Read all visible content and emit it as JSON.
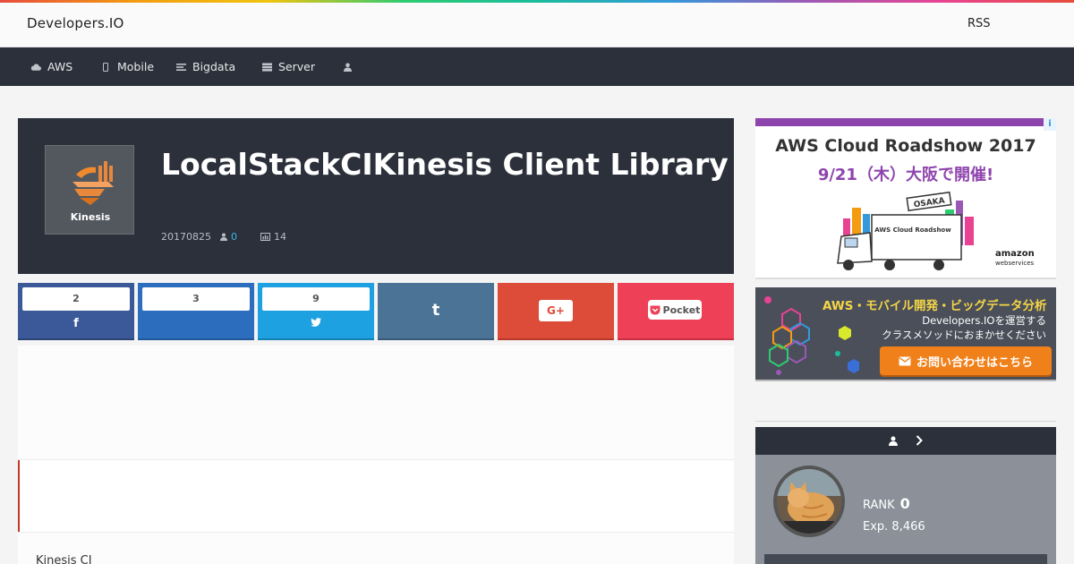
{
  "header": {
    "brand": "Developers.IO",
    "rss": "RSS"
  },
  "nav": {
    "items": [
      {
        "label": "AWS",
        "icon": "cloud-icon"
      },
      {
        "label": "Mobile",
        "icon": "mobile-icon"
      },
      {
        "label": "Bigdata",
        "icon": "bigdata-icon"
      },
      {
        "label": "Server",
        "icon": "server-icon"
      },
      {
        "label": "",
        "icon": "user-icon"
      }
    ]
  },
  "article": {
    "logo_label": "Kinesis",
    "title": "LocalStackCIKinesis Client Library",
    "date": "20170825",
    "comments": "0",
    "views": "14",
    "intro": "Kinesis CI"
  },
  "share": {
    "facebook": {
      "count": "2",
      "glyph": "f",
      "color": "#3b5998"
    },
    "hatena": {
      "count": "3",
      "color": "#2c6ebd"
    },
    "twitter": {
      "count": "9",
      "glyph": "t",
      "color": "#1da1e0"
    },
    "tumblr": {
      "glyph": "t",
      "color": "#4a7396"
    },
    "googleplus": {
      "glyph": "G+",
      "color": "#dd4b39"
    },
    "pocket": {
      "glyph": "Pocket",
      "color": "#ee4056"
    }
  },
  "ads": {
    "roadshow": {
      "title": "AWS Cloud Roadshow 2017",
      "date": "9/21（木）大阪で開催!",
      "sign": "OSAKA",
      "truck_text": "AWS Cloud Roadshow",
      "sponsor": "amazon",
      "sponsor_sub": "webservices"
    },
    "classmethod": {
      "line1": "AWS・モバイル開発・ビッグデータ分析",
      "line2": "Developers.IOを運営する",
      "line3": "クラスメソッドにおまかせください",
      "button": "お問い合わせはこちら"
    }
  },
  "profile": {
    "rank_label": "RANK",
    "rank_value": "0",
    "exp": "Exp. 8,466"
  }
}
